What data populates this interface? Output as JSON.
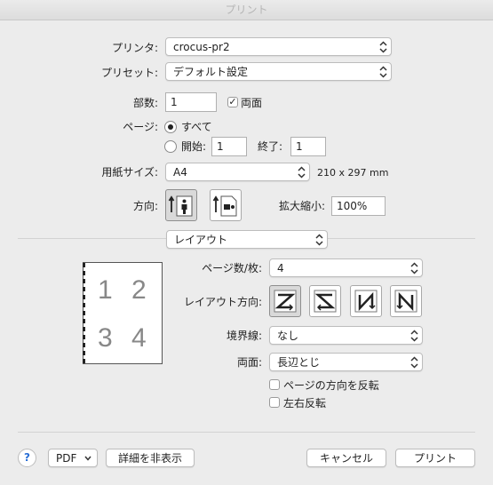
{
  "window": {
    "title": "プリント"
  },
  "printer": {
    "label": "プリンタ:",
    "value": "crocus-pr2"
  },
  "preset": {
    "label": "プリセット:",
    "value": "デフォルト設定"
  },
  "copies": {
    "label": "部数:",
    "value": "1",
    "duplex_label": "両面",
    "duplex_checked": true
  },
  "pages": {
    "label": "ページ:",
    "all_label": "すべて",
    "from_label": "開始:",
    "from_value": "1",
    "to_label": "終了:",
    "to_value": "1"
  },
  "paper": {
    "label": "用紙サイズ:",
    "value": "A4",
    "dimensions": "210 x 297 mm"
  },
  "orientation": {
    "label": "方向:",
    "options": [
      "portrait-icon",
      "landscape-icon"
    ]
  },
  "scale": {
    "label": "拡大縮小:",
    "value": "100%"
  },
  "section": {
    "value": "レイアウト"
  },
  "layout": {
    "pages_per_sheet_label": "ページ数/枚:",
    "pages_per_sheet": "4",
    "direction_label": "レイアウト方向:",
    "border_label": "境界線:",
    "border": "なし",
    "two_sided_label": "両面:",
    "two_sided": "長辺とじ",
    "reverse_orientation_label": "ページの方向を反転",
    "flip_horizontal_label": "左右反転",
    "preview_numbers": [
      "1",
      "2",
      "3",
      "4"
    ]
  },
  "footer": {
    "help": "?",
    "pdf": "PDF",
    "hide_details": "詳細を非表示",
    "cancel": "キャンセル",
    "print": "プリント"
  }
}
